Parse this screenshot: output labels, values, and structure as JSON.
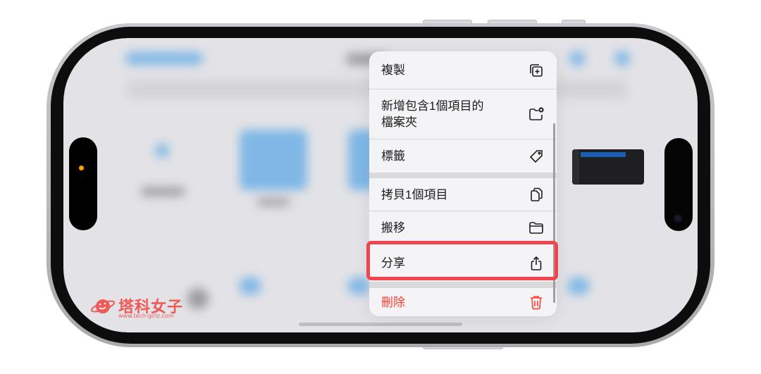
{
  "context_menu": {
    "items": [
      {
        "label": "複製",
        "icon": "duplicate-icon"
      },
      {
        "label": "新增包含1個項目的\n檔案夾",
        "icon": "new-folder-icon"
      },
      {
        "label": "標籤",
        "icon": "tag-icon"
      },
      {
        "label": "拷貝1個項目",
        "icon": "copy-icon"
      },
      {
        "label": "搬移",
        "icon": "folder-icon"
      },
      {
        "label": "分享",
        "icon": "share-icon"
      },
      {
        "label": "刪除",
        "icon": "trash-icon"
      }
    ],
    "highlighted_item": "分享"
  },
  "colors": {
    "highlight": "#f0454f",
    "destructive": "#ff3b30",
    "menu_bg": "#f5f5f7",
    "watermark": "#ef5a57"
  },
  "watermark": {
    "brand": "塔科女子",
    "url": "www.tech-girlz.com"
  }
}
